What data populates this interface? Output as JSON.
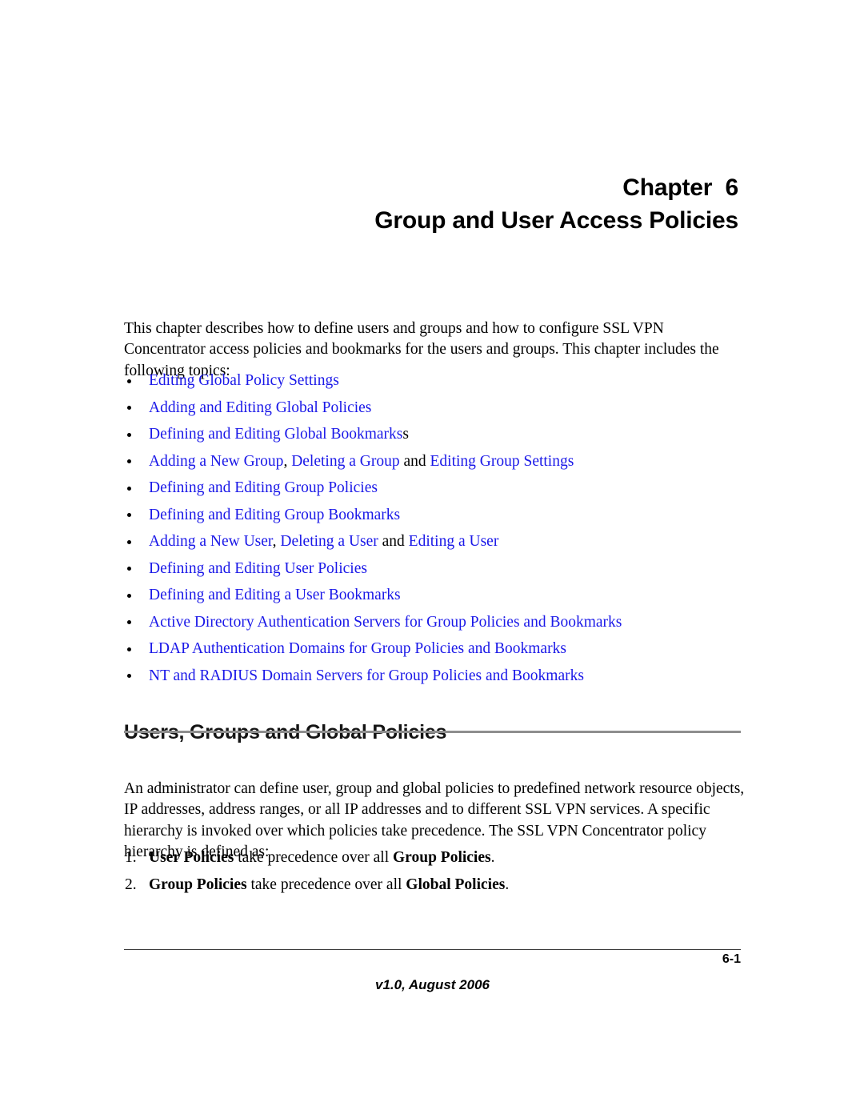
{
  "chapter": {
    "label": "Chapter",
    "number": "6",
    "number_line": "Chapter  6",
    "title": "Group and User Access Policies"
  },
  "intro": {
    "paragraph": "This chapter describes how to define users and groups and how to configure SSL VPN Concentrator access policies and bookmarks for the users and groups. This chapter includes the following topics:"
  },
  "topics": {
    "bullet_glyph": "•",
    "link_color": "#1a18e8",
    "items": [
      {
        "segments": [
          {
            "text": "Editing Global Policy Settings",
            "link": true
          }
        ]
      },
      {
        "segments": [
          {
            "text": "Adding and Editing Global Policies",
            "link": true
          }
        ]
      },
      {
        "segments": [
          {
            "text": "Defining and Editing Global Bookmarks",
            "link": true
          },
          {
            "text": "s",
            "link": false
          }
        ]
      },
      {
        "segments": [
          {
            "text": "Adding a New Group",
            "link": true
          },
          {
            "text": ", ",
            "link": false
          },
          {
            "text": "Deleting a Group",
            "link": true
          },
          {
            "text": " and ",
            "link": false
          },
          {
            "text": "Editing Group Settings",
            "link": true
          }
        ]
      },
      {
        "segments": [
          {
            "text": "Defining and Editing Group Policies",
            "link": true
          }
        ]
      },
      {
        "segments": [
          {
            "text": "Defining and Editing Group Bookmarks",
            "link": true
          }
        ]
      },
      {
        "segments": [
          {
            "text": "Adding a New User",
            "link": true
          },
          {
            "text": ", ",
            "link": false
          },
          {
            "text": "Deleting a User",
            "link": true
          },
          {
            "text": " and ",
            "link": false
          },
          {
            "text": "Editing a User",
            "link": true
          }
        ]
      },
      {
        "segments": [
          {
            "text": "Defining and Editing User Policies",
            "link": true
          }
        ]
      },
      {
        "segments": [
          {
            "text": "Defining and Editing a User Bookmarks",
            "link": true
          }
        ]
      },
      {
        "segments": [
          {
            "text": "Active Directory Authentication Servers for Group Policies and Bookmarks",
            "link": true
          }
        ]
      },
      {
        "segments": [
          {
            "text": "LDAP Authentication Domains for Group Policies and Bookmarks",
            "link": true
          }
        ]
      },
      {
        "segments": [
          {
            "text": "NT and RADIUS Domain Servers for Group Policies and Bookmarks",
            "link": true
          }
        ]
      }
    ]
  },
  "section": {
    "heading": "Users, Groups and Global Policies",
    "paragraph": "An administrator can define user, group and global policies to predefined network resource objects, IP addresses, address ranges, or all IP addresses and to different SSL VPN services. A specific hierarchy is invoked over which policies take precedence. The SSL VPN Concentrator policy hierarchy is defined as:"
  },
  "hierarchy": {
    "items": [
      {
        "number": "1.",
        "segments": [
          {
            "text": "User Policies",
            "bold": true
          },
          {
            "text": " take precedence over all ",
            "bold": false
          },
          {
            "text": "Group Policies",
            "bold": true
          },
          {
            "text": ".",
            "bold": false
          }
        ]
      },
      {
        "number": "2.",
        "segments": [
          {
            "text": "Group Policies",
            "bold": true
          },
          {
            "text": " take precedence over all ",
            "bold": false
          },
          {
            "text": "Global Policies",
            "bold": true
          },
          {
            "text": ".",
            "bold": false
          }
        ]
      }
    ]
  },
  "footer": {
    "page_number": "6-1",
    "version": "v1.0, August 2006"
  }
}
